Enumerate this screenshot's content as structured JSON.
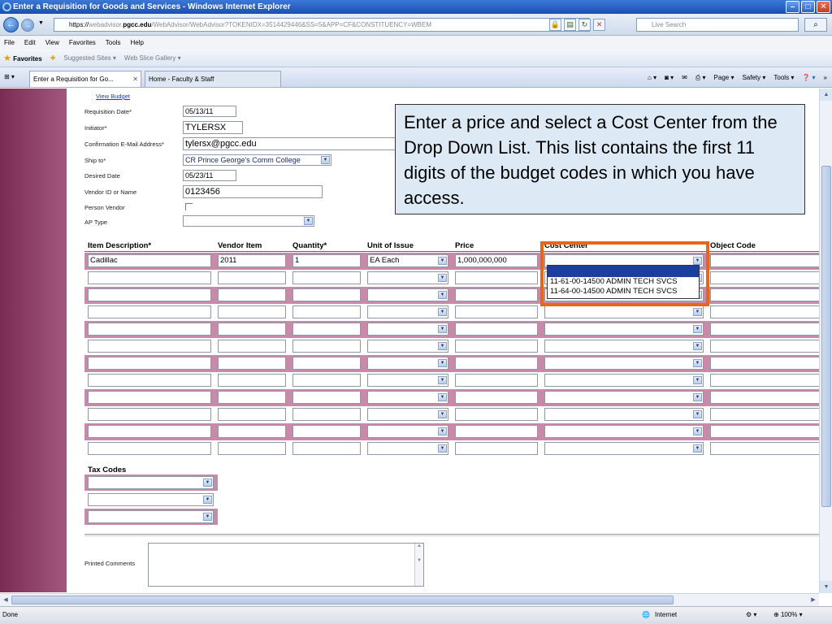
{
  "window": {
    "title": "Enter a Requisition for Goods and Services - Windows Internet Explorer",
    "minimize": "–",
    "maximize": "□",
    "close": "✕"
  },
  "address": {
    "scheme": "https://",
    "sub": "webadvisor.",
    "host": "pgcc.edu",
    "path": "/WebAdvisor/WebAdvisor?TOKENIDX=3514429446&SS=5&APP=CF&CONSTITUENCY=WBEM",
    "search_placeholder": "Live Search"
  },
  "menu": [
    "File",
    "Edit",
    "View",
    "Favorites",
    "Tools",
    "Help"
  ],
  "favorites": {
    "label": "Favorites",
    "suggested": "Suggested Sites",
    "slice": "Web Slice Gallery"
  },
  "tabs": [
    {
      "label": "Enter a Requisition for Go...",
      "active": true
    },
    {
      "label": "Home - Faculty & Staff",
      "active": false
    }
  ],
  "commands": [
    "Page",
    "Safety",
    "Tools"
  ],
  "form": {
    "view_budget": "View Budget",
    "requisition_date_label": "Requisition Date*",
    "requisition_date": "05/13/11",
    "initiator_label": "Initiator*",
    "initiator": "TYLERSX",
    "email_label": "Confirmation E-Mail Address*",
    "email": "tylersx@pgcc.edu",
    "ship_to_label": "Ship to*",
    "ship_to": "CR Prince George's Comm College",
    "desired_date_label": "Desired Date",
    "desired_date": "05/23/11",
    "vendor_label": "Vendor ID or Name",
    "vendor": "0123456",
    "person_vendor_label": "Person Vendor",
    "ap_type_label": "AP Type"
  },
  "table": {
    "headers": [
      "Item Description*",
      "Vendor Item",
      "Quantity*",
      "Unit of Issue",
      "Price",
      "Cost Center",
      "Object Code"
    ],
    "first_row": {
      "description": "Cadillac",
      "vendor_item": "2011",
      "quantity": "1",
      "unit": "EA Each",
      "price": "1,000,000,000"
    },
    "cost_center_options": [
      "11-61-00-14500 ADMIN TECH SVCS",
      "11-64-00-14500 ADMIN TECH SVCS"
    ]
  },
  "tax_codes_label": "Tax Codes",
  "printed_comments_label": "Printed Comments",
  "tooltip": "Enter a price and select a Cost Center from the Drop Down List. This list contains the first 11 digits of the budget codes in which you have access.",
  "status": {
    "left": "Done",
    "zone": "Internet",
    "zoom": "100%"
  },
  "colors": {
    "accent_orange": "#e8661a",
    "row_pink": "#c88aa8",
    "sidebar": "#8a3a64",
    "tooltip_bg": "#dde9f4"
  }
}
